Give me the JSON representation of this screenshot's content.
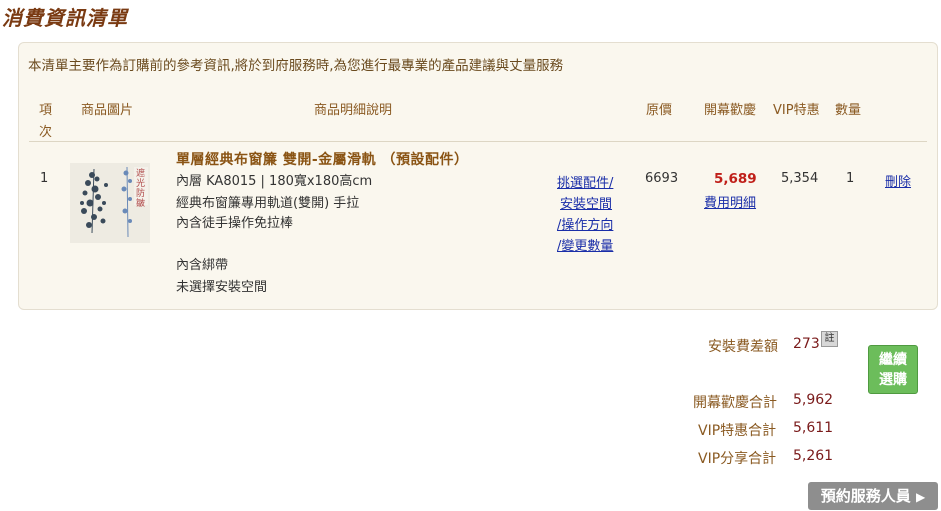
{
  "page": {
    "title": "消費資訊清單"
  },
  "intro_text": "本清單主要作為訂購前的參考資訊,將於到府服務時,為您進行最專業的產品建議與丈量服務",
  "table": {
    "headers": {
      "index_line1": "項",
      "index_line2": "次",
      "image": "商品圖片",
      "description": "商品明細說明",
      "original_price": "原價",
      "promo_price": "開幕歡慶",
      "vip_price": "VIP特惠",
      "quantity": "數量"
    },
    "rows": [
      {
        "index": "1",
        "thumbnail_caption_1": "遮光",
        "thumbnail_caption_2": "防皺",
        "name": "單層經典布窗簾 雙開-金屬滑軌 （預設配件）",
        "spec": "內層 KA8015 | 180寬x180高cm",
        "accessory1": "經典布窗簾專用軌道(雙開) 手拉",
        "accessory2": "內含徒手操作免拉棒",
        "accessory3": "內含綁帶",
        "accessory4": "未選擇安裝空間",
        "options_link": [
          "挑選配件/",
          "安裝空間",
          "/操作方向",
          "/變更數量"
        ],
        "original_price": "6693",
        "promo_price": "5,689",
        "cost_detail_link": "費用明細",
        "vip_price": "5,354",
        "quantity": "1",
        "delete_label": "刪除"
      }
    ]
  },
  "summary": {
    "install_diff_label": "安裝費差額",
    "install_diff_value": "273",
    "note_label": "註",
    "promo_total_label": "開幕歡慶合計",
    "promo_total_value": "5,962",
    "vip_total_label": "VIP特惠合計",
    "vip_total_value": "5,611",
    "vip_share_total_label": "VIP分享合計",
    "vip_share_total_value": "5,261"
  },
  "buttons": {
    "continue_line1": "繼續",
    "continue_line2": "選購",
    "book_service": "預約服務人員"
  },
  "icons": {
    "book_arrow": "triangle-right-icon"
  },
  "colors": {
    "accent_brown": "#8a5a22",
    "green_button": "#6cbd5b",
    "promo_red": "#c0201a"
  }
}
